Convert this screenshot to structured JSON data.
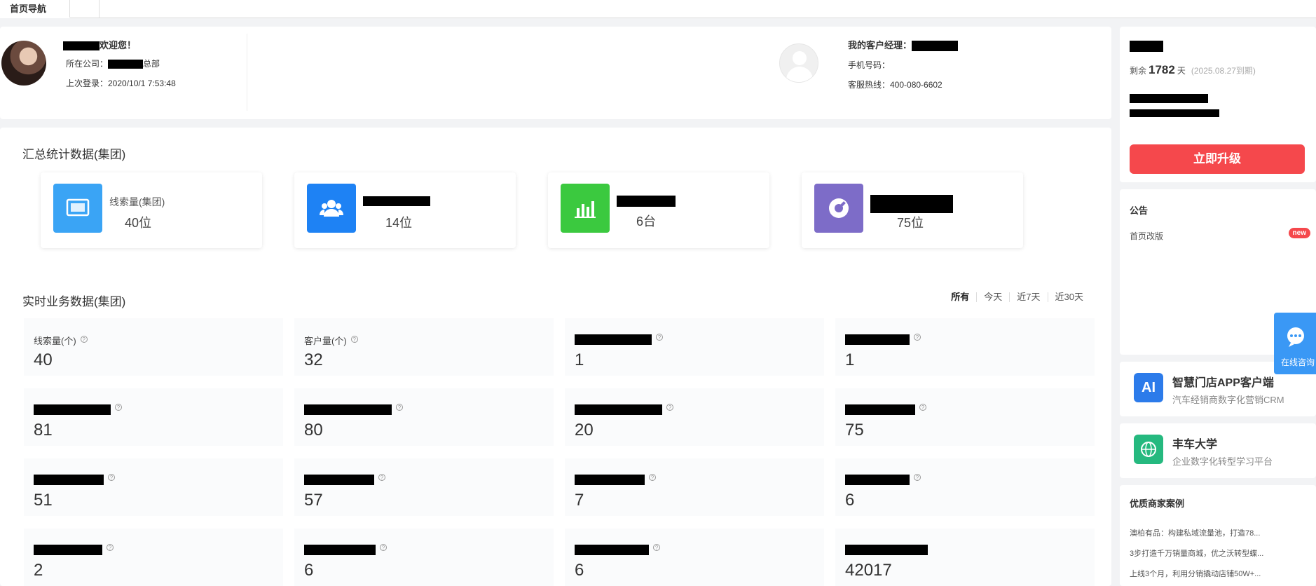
{
  "tabs": {
    "home": "首页导航",
    "empty": ""
  },
  "profile": {
    "welcome": "欢迎您！",
    "company_label": "所在公司：",
    "company_suffix": "总部",
    "last_login": "上次登录：2020/10/1 7:53:48"
  },
  "manager": {
    "title": "我的客户经理：",
    "phone_label": "手机号码：",
    "hotline": "客服热线：400-080-6602"
  },
  "stats": {
    "title": "汇总统计数据(集团)",
    "cards": [
      {
        "label": "线索量(集团)",
        "value": "40位",
        "color": "#3aa4f5",
        "icon": "display-icon"
      },
      {
        "label": "",
        "value": "14位",
        "color": "#1e82f4",
        "icon": "users-icon"
      },
      {
        "label": "",
        "value": "6台",
        "color": "#3bc93f",
        "icon": "bar-chart-icon"
      },
      {
        "label": "",
        "value": "75位",
        "color": "#7d6cc8",
        "icon": "wrench-icon"
      }
    ]
  },
  "realtime": {
    "title": "实时业务数据(集团)",
    "filters": [
      "所有",
      "今天",
      "近7天",
      "近30天"
    ],
    "cells": [
      {
        "label": "线索量(个)",
        "value": "40"
      },
      {
        "label": "客户量(个)",
        "value": "32"
      },
      {
        "label": "",
        "value": "1"
      },
      {
        "label": "",
        "value": "1"
      },
      {
        "label": "",
        "value": "81"
      },
      {
        "label": "",
        "value": "80"
      },
      {
        "label": "",
        "value": "20"
      },
      {
        "label": "",
        "value": "75"
      },
      {
        "label": "",
        "value": "51"
      },
      {
        "label": "",
        "value": "57"
      },
      {
        "label": "",
        "value": "7"
      },
      {
        "label": "",
        "value": "6"
      },
      {
        "label": "",
        "value": "2"
      },
      {
        "label": "",
        "value": "6"
      },
      {
        "label": "",
        "value": "6"
      },
      {
        "label": "",
        "value": "42017"
      }
    ]
  },
  "vip": {
    "remaining_prefix": "剩余",
    "days": "1782",
    "days_unit": "天",
    "expiry": "(2025.08.27到期)",
    "upgrade": "立即升级"
  },
  "notice": {
    "title": "公告",
    "item": "首页改版",
    "badge": "new"
  },
  "apps": [
    {
      "icon_text": "AI",
      "title": "智慧门店APP客户端",
      "subtitle": "汽车经销商数字化营销CRM",
      "color": "#2c7bea"
    },
    {
      "icon_text": "",
      "title": "丰车大学",
      "subtitle": "企业数字化转型学习平台",
      "color": "#25b97f"
    }
  ],
  "cases": {
    "title": "优质商家案例",
    "items": [
      "澳柏有品：构建私域流量池，打造78...",
      "3步打造千万销量商城，优之沃转型蝶...",
      "上线3个月，利用分销撬动店铺50W+..."
    ]
  },
  "consult": {
    "label": "在线咨询"
  }
}
